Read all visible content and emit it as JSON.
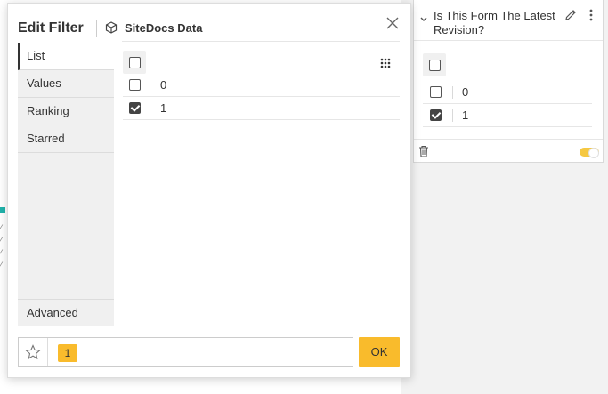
{
  "dialog": {
    "title": "Edit Filter",
    "subtitle": "SiteDocs Data",
    "tabs": [
      {
        "label": "List"
      },
      {
        "label": "Values"
      },
      {
        "label": "Ranking"
      },
      {
        "label": "Starred"
      }
    ],
    "advanced_label": "Advanced",
    "list": {
      "rows": [
        {
          "label": "0",
          "checked": false
        },
        {
          "label": "1",
          "checked": true
        }
      ]
    },
    "footer": {
      "selected_badge": "1",
      "ok_label": "OK"
    }
  },
  "card": {
    "title": "Is This Form The Latest Revision?",
    "rows": [
      {
        "label": "0",
        "checked": false
      },
      {
        "label": "1",
        "checked": true
      }
    ]
  },
  "colors": {
    "accent": "#f9bb2c",
    "tab_bg": "#f0f0f0",
    "teal": "#20b2aa"
  },
  "icons": [
    "cube-icon",
    "close-icon",
    "grid-icon",
    "star-icon",
    "chevron-down-icon",
    "pencil-icon",
    "kebab-icon",
    "trash-icon"
  ]
}
